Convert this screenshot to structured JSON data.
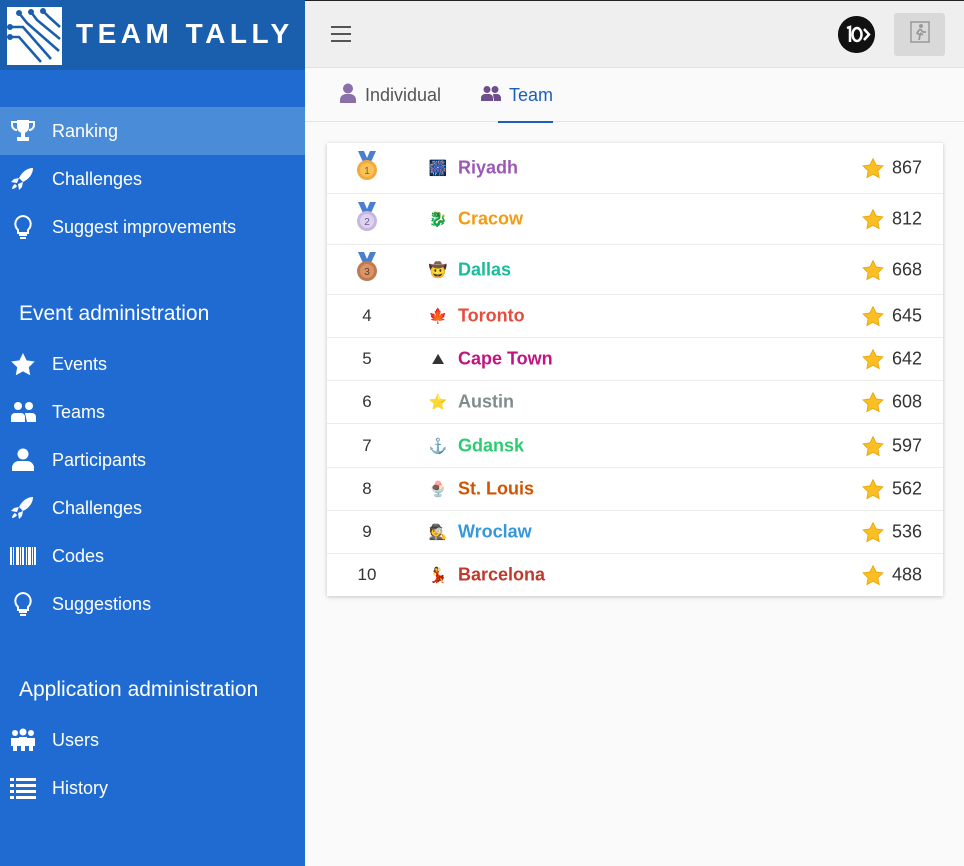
{
  "app": {
    "title": "TEAM TALLY"
  },
  "sidebar": {
    "main_items": [
      {
        "label": "Ranking",
        "icon": "trophy-icon",
        "active": true
      },
      {
        "label": "Challenges",
        "icon": "rocket-icon"
      },
      {
        "label": "Suggest improvements",
        "icon": "lightbulb-icon"
      }
    ],
    "event_admin": {
      "title": "Event administration",
      "items": [
        {
          "label": "Events",
          "icon": "star-icon"
        },
        {
          "label": "Teams",
          "icon": "team-icon"
        },
        {
          "label": "Participants",
          "icon": "user-icon"
        },
        {
          "label": "Challenges",
          "icon": "rocket-icon"
        },
        {
          "label": "Codes",
          "icon": "barcode-icon"
        },
        {
          "label": "Suggestions",
          "icon": "lightbulb-icon"
        }
      ]
    },
    "app_admin": {
      "title": "Application administration",
      "items": [
        {
          "label": "Users",
          "icon": "users-icon"
        },
        {
          "label": "History",
          "icon": "list-icon"
        }
      ]
    }
  },
  "tabs": [
    {
      "label": "Individual",
      "icon": "person-icon",
      "active": false
    },
    {
      "label": "Team",
      "icon": "people-icon",
      "active": true
    }
  ],
  "ranking": {
    "rows": [
      {
        "rank": "1",
        "medal": "gold",
        "emoji": "🎆",
        "name": "Riyadh",
        "color": "#9b59b6",
        "points": "867"
      },
      {
        "rank": "2",
        "medal": "silver",
        "emoji": "🐉",
        "name": "Cracow",
        "color": "#f39c12",
        "points": "812"
      },
      {
        "rank": "3",
        "medal": "bronze",
        "emoji": "🤠",
        "name": "Dallas",
        "color": "#1abc9c",
        "points": "668"
      },
      {
        "rank": "4",
        "emoji": "🍁",
        "name": "Toronto",
        "color": "#e74c3c",
        "points": "645"
      },
      {
        "rank": "5",
        "emoji": "⛰",
        "name": "Cape Town",
        "color": "#c0157e",
        "points": "642"
      },
      {
        "rank": "6",
        "emoji": "⭐",
        "name": "Austin",
        "color": "#7f8c8d",
        "points": "608"
      },
      {
        "rank": "7",
        "emoji": "⚓",
        "name": "Gdansk",
        "color": "#2ecc71",
        "points": "597"
      },
      {
        "rank": "8",
        "emoji": "🍨",
        "name": "St. Louis",
        "color": "#d35400",
        "points": "562"
      },
      {
        "rank": "9",
        "emoji": "🕵",
        "name": "Wroclaw",
        "color": "#3498db",
        "points": "536"
      },
      {
        "rank": "10",
        "emoji": "💃",
        "name": "Barcelona",
        "color": "#c0392b",
        "points": "488"
      }
    ]
  }
}
